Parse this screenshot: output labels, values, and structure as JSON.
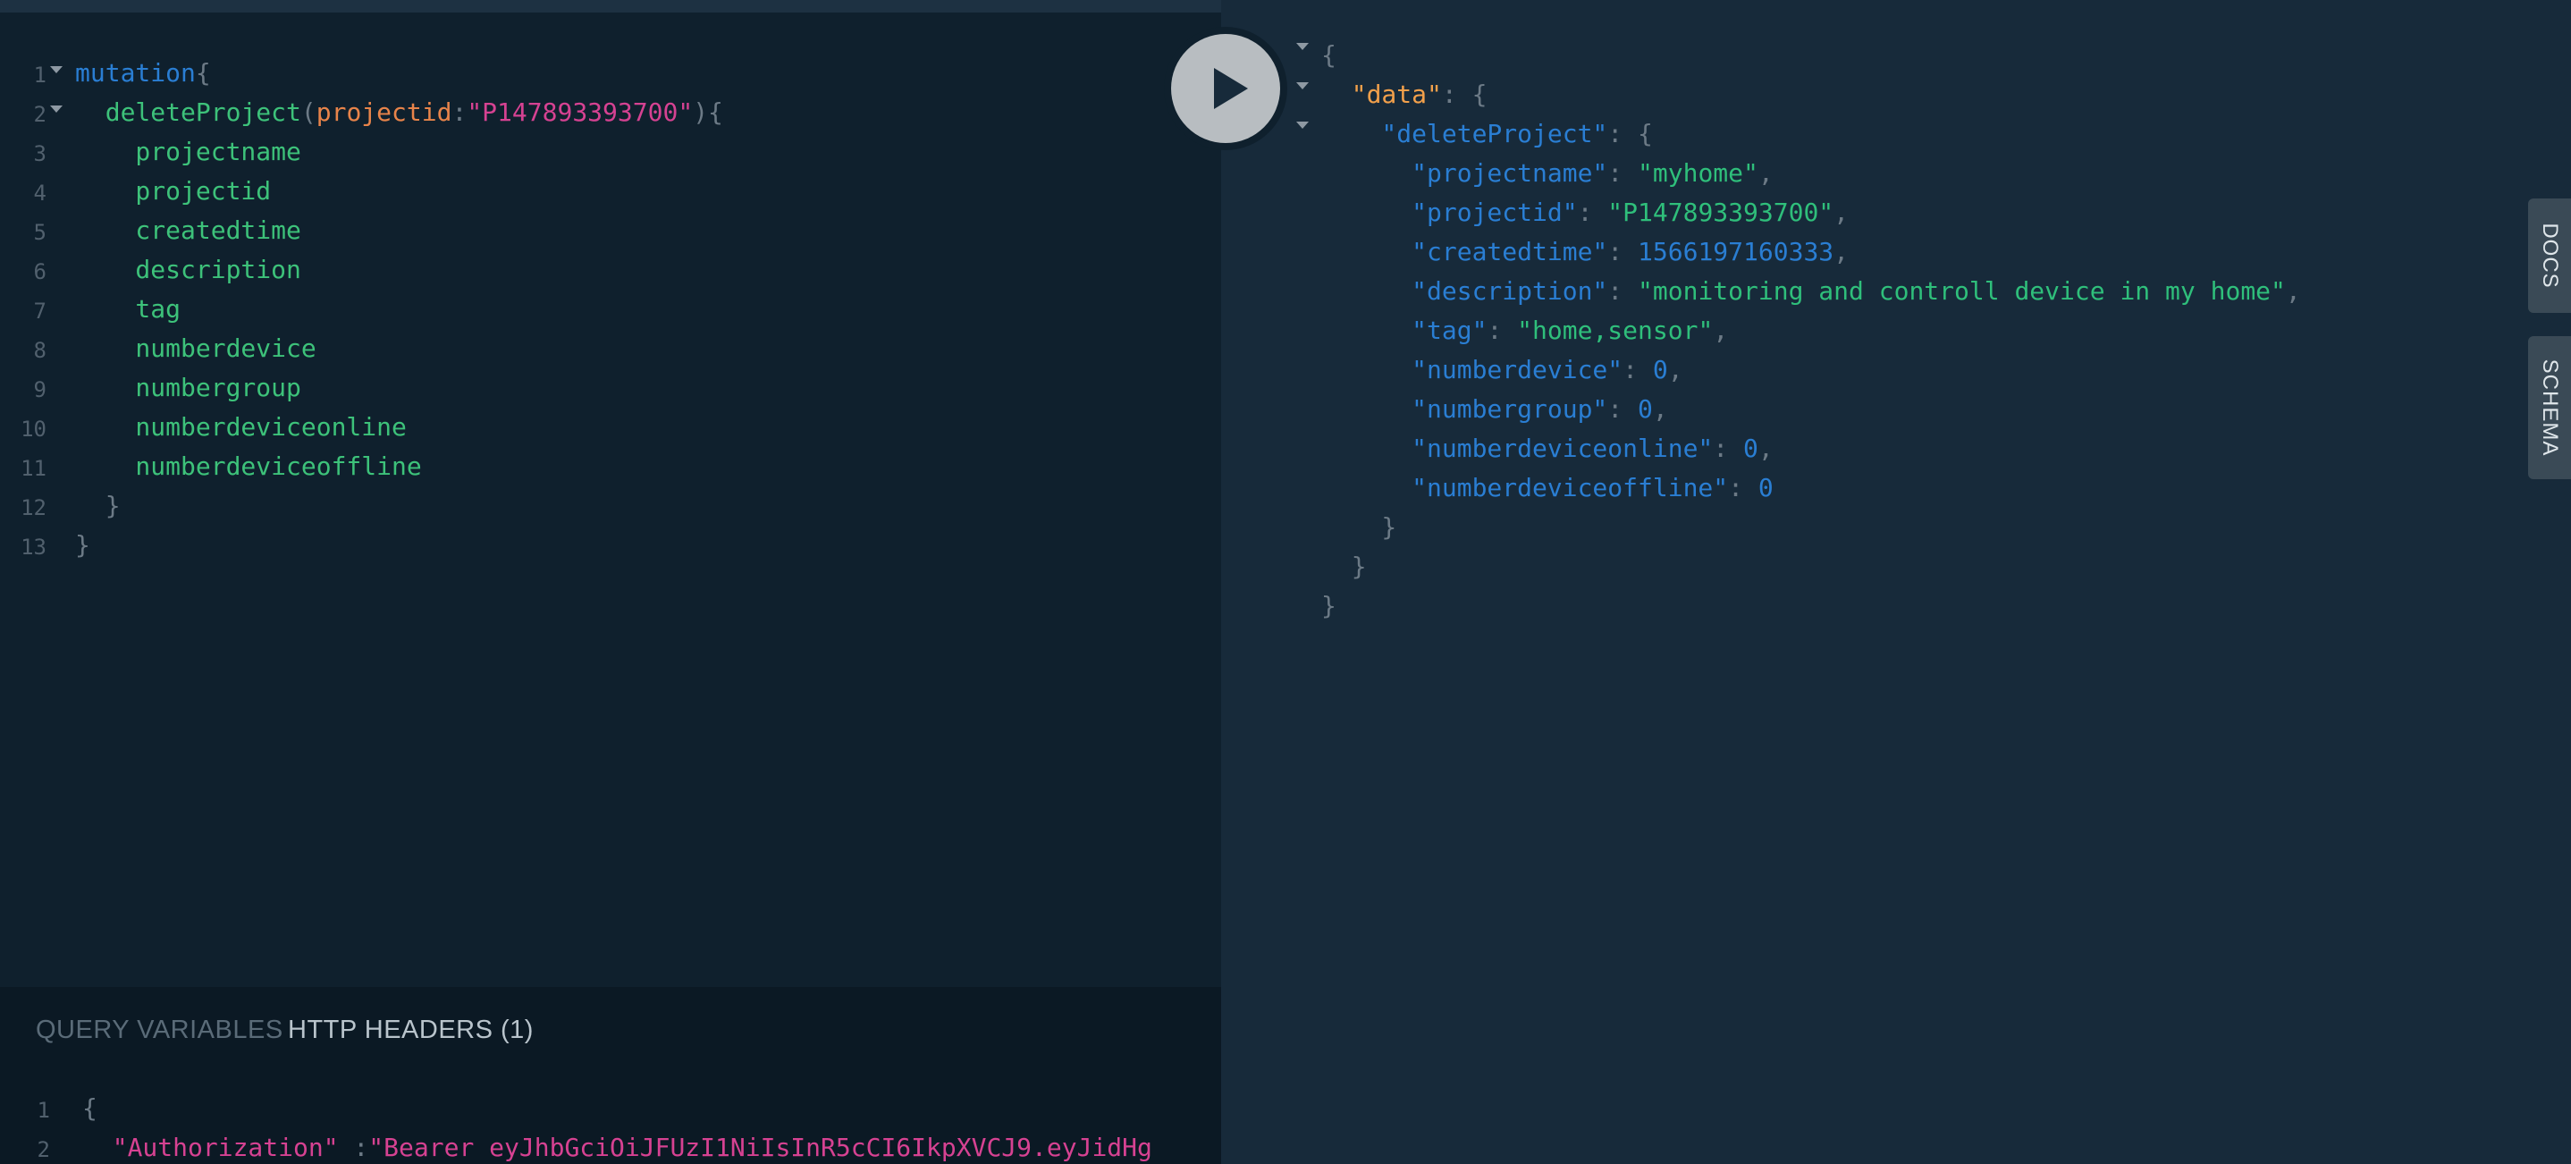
{
  "editor": {
    "line_numbers": [
      "1",
      "2",
      "3",
      "4",
      "5",
      "6",
      "7",
      "8",
      "9",
      "10",
      "11",
      "12",
      "13"
    ],
    "lines": [
      [
        {
          "c": "kw",
          "t": "mutation"
        },
        {
          "c": "punc",
          "t": "{"
        }
      ],
      [
        {
          "c": "field",
          "t": "  deleteProject"
        },
        {
          "c": "punc",
          "t": "("
        },
        {
          "c": "arg",
          "t": "projectid"
        },
        {
          "c": "punc",
          "t": ":"
        },
        {
          "c": "str",
          "t": "\"P147893393700\""
        },
        {
          "c": "punc",
          "t": "){"
        }
      ],
      [
        {
          "c": "field",
          "t": "    projectname"
        }
      ],
      [
        {
          "c": "field",
          "t": "    projectid"
        }
      ],
      [
        {
          "c": "field",
          "t": "    createdtime"
        }
      ],
      [
        {
          "c": "field",
          "t": "    description"
        }
      ],
      [
        {
          "c": "field",
          "t": "    tag"
        }
      ],
      [
        {
          "c": "field",
          "t": "    numberdevice"
        }
      ],
      [
        {
          "c": "field",
          "t": "    numbergroup"
        }
      ],
      [
        {
          "c": "field",
          "t": "    numberdeviceonline"
        }
      ],
      [
        {
          "c": "field",
          "t": "    numberdeviceoffline"
        }
      ],
      [
        {
          "c": "punc",
          "t": "  }"
        }
      ],
      [
        {
          "c": "punc",
          "t": "}"
        }
      ]
    ]
  },
  "play_button": {
    "icon": "play-icon"
  },
  "bottom_tabs": {
    "query_variables": "QUERY VARIABLES",
    "http_headers": "HTTP HEADERS (1)"
  },
  "headers_editor": {
    "line_numbers": [
      "1",
      "2"
    ],
    "lines": [
      [
        {
          "c": "punc",
          "t": "{"
        }
      ],
      [
        {
          "c": "str",
          "t": "  \"Authorization\""
        },
        {
          "c": "punc",
          "t": " :"
        },
        {
          "c": "str",
          "t": "\"Bearer eyJhbGciOiJFUzI1NiIsInR5cCI6IkpXVCJ9.eyJidHg"
        }
      ]
    ]
  },
  "results": {
    "lines": [
      [
        {
          "c": "punc",
          "t": "{"
        }
      ],
      [
        {
          "c": "jdata",
          "t": "  \"data\""
        },
        {
          "c": "punc",
          "t": ": {"
        }
      ],
      [
        {
          "c": "jkey",
          "t": "    \"deleteProject\""
        },
        {
          "c": "punc",
          "t": ": {"
        }
      ],
      [
        {
          "c": "jkey",
          "t": "      \"projectname\""
        },
        {
          "c": "punc",
          "t": ": "
        },
        {
          "c": "jstr",
          "t": "\"myhome\""
        },
        {
          "c": "punc",
          "t": ","
        }
      ],
      [
        {
          "c": "jkey",
          "t": "      \"projectid\""
        },
        {
          "c": "punc",
          "t": ": "
        },
        {
          "c": "jstr",
          "t": "\"P147893393700\""
        },
        {
          "c": "punc",
          "t": ","
        }
      ],
      [
        {
          "c": "jkey",
          "t": "      \"createdtime\""
        },
        {
          "c": "punc",
          "t": ": "
        },
        {
          "c": "jnum",
          "t": "1566197160333"
        },
        {
          "c": "punc",
          "t": ","
        }
      ],
      [
        {
          "c": "jkey",
          "t": "      \"description\""
        },
        {
          "c": "punc",
          "t": ": "
        },
        {
          "c": "jstr",
          "t": "\"monitoring and controll device in my home\""
        },
        {
          "c": "punc",
          "t": ","
        }
      ],
      [
        {
          "c": "jkey",
          "t": "      \"tag\""
        },
        {
          "c": "punc",
          "t": ": "
        },
        {
          "c": "jstr",
          "t": "\"home,sensor\""
        },
        {
          "c": "punc",
          "t": ","
        }
      ],
      [
        {
          "c": "jkey",
          "t": "      \"numberdevice\""
        },
        {
          "c": "punc",
          "t": ": "
        },
        {
          "c": "jnum",
          "t": "0"
        },
        {
          "c": "punc",
          "t": ","
        }
      ],
      [
        {
          "c": "jkey",
          "t": "      \"numbergroup\""
        },
        {
          "c": "punc",
          "t": ": "
        },
        {
          "c": "jnum",
          "t": "0"
        },
        {
          "c": "punc",
          "t": ","
        }
      ],
      [
        {
          "c": "jkey",
          "t": "      \"numberdeviceonline\""
        },
        {
          "c": "punc",
          "t": ": "
        },
        {
          "c": "jnum",
          "t": "0"
        },
        {
          "c": "punc",
          "t": ","
        }
      ],
      [
        {
          "c": "jkey",
          "t": "      \"numberdeviceoffline\""
        },
        {
          "c": "punc",
          "t": ": "
        },
        {
          "c": "jnum",
          "t": "0"
        }
      ],
      [
        {
          "c": "punc",
          "t": "    }"
        }
      ],
      [
        {
          "c": "punc",
          "t": "  }"
        }
      ],
      [
        {
          "c": "punc",
          "t": "}"
        }
      ]
    ]
  },
  "side_tabs": {
    "docs": "DOCS",
    "schema": "SCHEMA"
  },
  "colors": {
    "editor_bg": "#0f202d",
    "results_bg": "#172a3a",
    "field": "#3dc27a",
    "keyword": "#2a7ed3",
    "string": "#d64292",
    "argument": "#e8844a",
    "json_data_key": "#f2a04b"
  }
}
